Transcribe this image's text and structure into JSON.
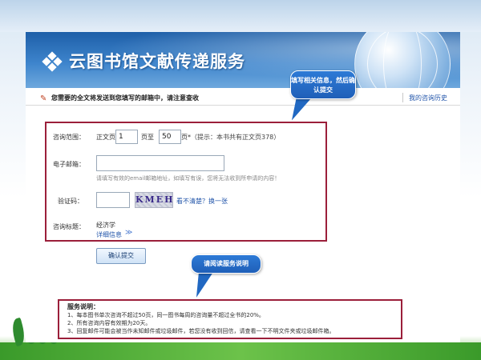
{
  "header": {
    "title": "云图书馆文献传递服务"
  },
  "notice": {
    "text": "您需要的全文将发送到您填写的邮箱中，请注意查收",
    "history_link": "我的咨询历史"
  },
  "callouts": {
    "fill_info": "填写相关信息，然后确认提交",
    "read_terms": "请阅读服务说明"
  },
  "form": {
    "range_label": "咨询范围：",
    "body_pages_label": "正文页",
    "from_value": "1",
    "to_label": "页至",
    "to_value": "50",
    "page_suffix": "页*",
    "hint": "（提示：本书共有正文页378）",
    "email_label": "电子邮箱：",
    "email_value": "",
    "email_hint": "请填写有效的email邮箱地址，如填写有误，您将无法收到所申请的内容！",
    "captcha_label": "验证码：",
    "captcha_value": "",
    "captcha_text": "KMEH",
    "refresh_link": "看不清楚？换一张",
    "subject_label": "咨询标题：",
    "subject_value": "经济学",
    "details_link": "详细信息"
  },
  "submit_label": "确认提交",
  "service_info": {
    "title": "服务说明：",
    "items": [
      "1、每本图书单次咨询不超过50页，同一图书每周的咨询量不超过全书的20%。",
      "2、所有咨询内容有效期为20天。",
      "3、回复邮件可能会被当作未知邮件或垃圾邮件，若您没有收到回信，请查看一下不明文件夹或垃圾邮件箱。"
    ]
  },
  "colors": {
    "frame_border": "#9b1f3a",
    "callout_blue": "#2168c2",
    "link_blue": "#2255aa",
    "banner_blue": "#1e5fa8"
  }
}
